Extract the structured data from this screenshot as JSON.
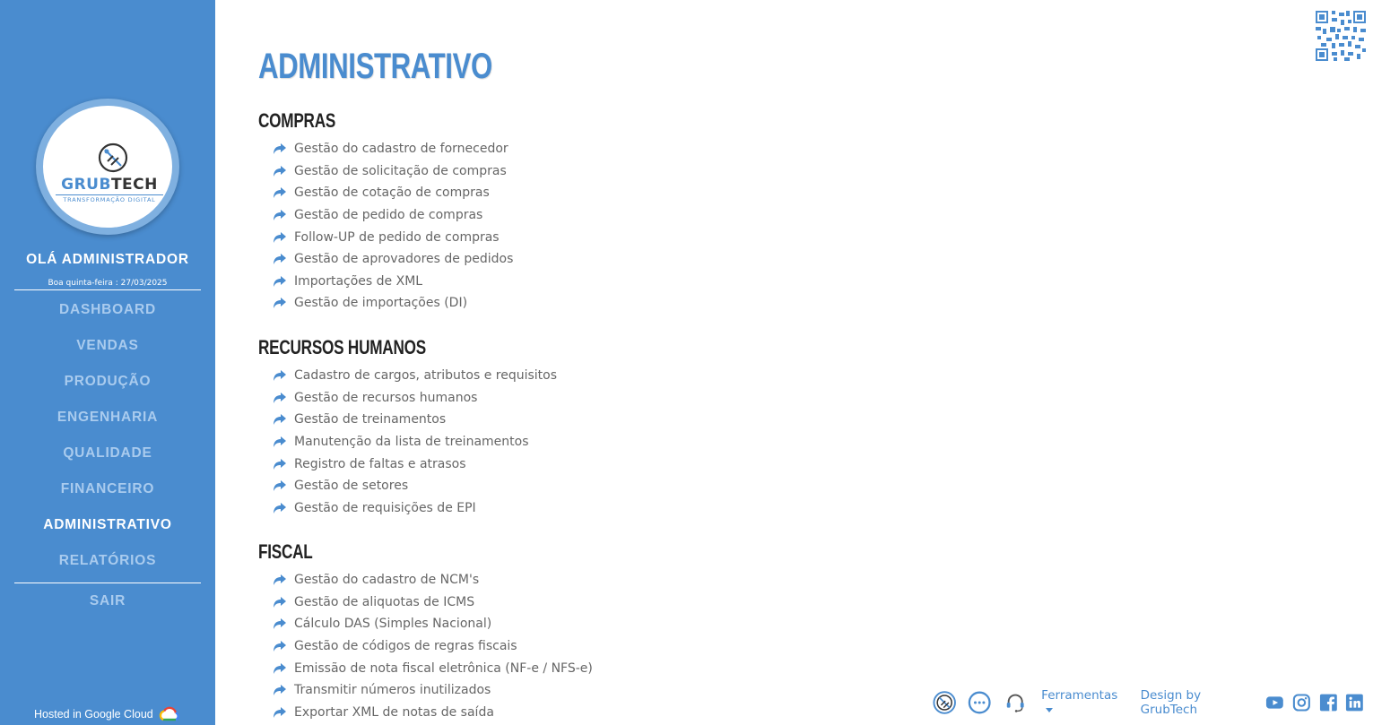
{
  "brand": {
    "logo_primary": "GRUB",
    "logo_secondary": "TECH",
    "logo_tagline": "TRANSFORMAÇÃO DIGITAL",
    "accent_color": "#4a8ccf"
  },
  "sidebar": {
    "greeting": "OLÁ ADMINISTRADOR",
    "date_line": "Boa quinta-feira : 27/03/2025",
    "items": [
      {
        "label": "DASHBOARD",
        "active": false
      },
      {
        "label": "VENDAS",
        "active": false
      },
      {
        "label": "PRODUÇÃO",
        "active": false
      },
      {
        "label": "ENGENHARIA",
        "active": false
      },
      {
        "label": "QUALIDADE",
        "active": false
      },
      {
        "label": "FINANCEIRO",
        "active": false
      },
      {
        "label": "ADMINISTRATIVO",
        "active": true
      },
      {
        "label": "RELATÓRIOS",
        "active": false
      }
    ],
    "exit_label": "SAIR",
    "hosted_label": "Hosted in Google Cloud"
  },
  "main": {
    "title": "ADMINISTRATIVO",
    "sections": [
      {
        "title": "COMPRAS",
        "items": [
          "Gestão do cadastro de fornecedor",
          "Gestão de solicitação de compras",
          "Gestão de cotação de compras",
          "Gestão de pedido de compras",
          "Follow-UP de pedido de compras",
          "Gestão de aprovadores de pedidos",
          "Importações de XML",
          "Gestão de importações (DI)"
        ]
      },
      {
        "title": "RECURSOS HUMANOS",
        "items": [
          "Cadastro de cargos, atributos e requisitos",
          "Gestão de recursos humanos",
          "Gestão de treinamentos",
          "Manutenção da lista de treinamentos",
          "Registro de faltas e atrasos",
          "Gestão de setores",
          "Gestão de requisições de EPI"
        ]
      },
      {
        "title": "FISCAL",
        "items": [
          "Gestão do cadastro de NCM's",
          "Gestão de aliquotas de ICMS",
          "Cálculo DAS (Simples Nacional)",
          "Gestão de códigos de regras fiscais",
          "Emissão de nota fiscal eletrônica (NF-e / NFS-e)",
          "Transmitir números inutilizados",
          "Exportar XML de notas de saída"
        ]
      }
    ]
  },
  "footer": {
    "tools_label": "Ferramentas",
    "design_label": "Design by GrubTech",
    "icons": [
      "grubtech-icon",
      "chat-icon",
      "support-headset-icon"
    ],
    "social": [
      "youtube-icon",
      "instagram-icon",
      "facebook-icon",
      "linkedin-icon"
    ]
  }
}
